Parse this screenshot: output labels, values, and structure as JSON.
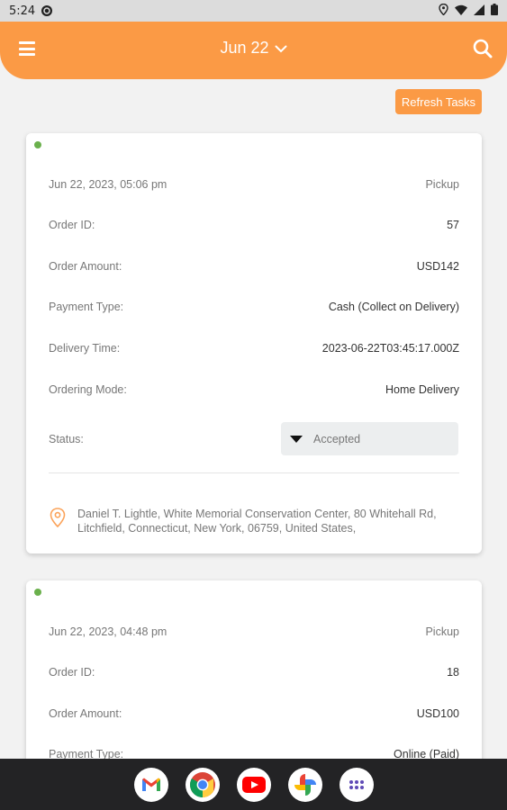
{
  "status_bar": {
    "time": "5:24"
  },
  "header": {
    "date_label": "Jun 22"
  },
  "actions": {
    "refresh_label": "Refresh Tasks"
  },
  "labels": {
    "order_id": "Order ID:",
    "order_amount": "Order Amount:",
    "payment_type": "Payment Type:",
    "delivery_time": "Delivery Time:",
    "ordering_mode": "Ordering Mode:",
    "status": "Status:"
  },
  "orders": [
    {
      "datetime": "Jun 22, 2023, 05:06 pm",
      "type": "Pickup",
      "order_id": "57",
      "order_amount": "USD142",
      "payment_type": "Cash (Collect on Delivery)",
      "delivery_time": "2023-06-22T03:45:17.000Z",
      "ordering_mode": "Home Delivery",
      "status": "Accepted",
      "address": "Daniel T. Lightle, White Memorial Conservation Center, 80 Whitehall Rd, Litchfield, Connecticut, New York, 06759, United States,"
    },
    {
      "datetime": "Jun 22, 2023, 04:48 pm",
      "type": "Pickup",
      "order_id": "18",
      "order_amount": "USD100",
      "payment_type": "Online (Paid)"
    }
  ],
  "dock_apps": [
    "gmail-icon",
    "chrome-icon",
    "youtube-icon",
    "photos-icon",
    "app-drawer-icon"
  ],
  "colors": {
    "accent": "#fb9a45",
    "status_dot": "#6ab04c"
  }
}
